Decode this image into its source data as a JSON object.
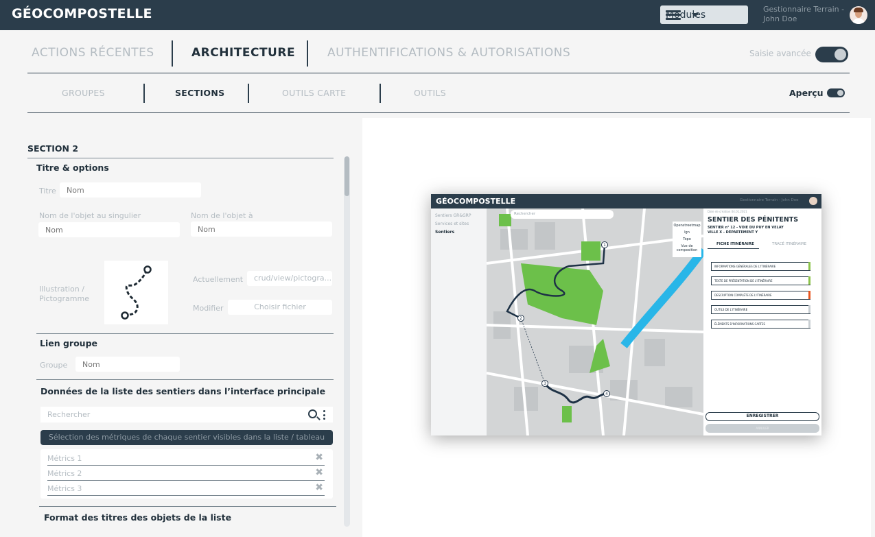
{
  "app": {
    "brand": "GÉOCOMPOSTELLE",
    "modules_label": "Modules",
    "user": "Gestionnaire Terrain - John Doe"
  },
  "main_tabs": {
    "recent": "ACTIONS RÉCENTES",
    "architecture": "ARCHITECTURE",
    "auth": "AUTHENTIFICATIONS & AUTORISATIONS",
    "active": "ARCHITECTURE"
  },
  "saisie_avancee": {
    "label": "Saisie avancée",
    "on": true
  },
  "sub_tabs": {
    "groupes": "GROUPES",
    "sections": "SECTIONS",
    "outils_carte": "OUTILS CARTE",
    "outils": "OUTILS",
    "active": "SECTIONS"
  },
  "apercu": {
    "label": "Aperçu",
    "on": true
  },
  "form": {
    "section_title": "SECTION 2",
    "titre_options": {
      "heading": "Titre & options",
      "titre_label": "Titre",
      "titre_placeholder": "Nom",
      "singular_label": "Nom de l'objet au singulier",
      "singular_placeholder": "Nom",
      "a_label": "Nom de l'objet à",
      "a_placeholder": "Nom",
      "picto_label": "Illustration / Pictogramme",
      "actuellement_label": "Actuellement",
      "actuellement_value": "crud/view/pictogra...",
      "modifier_label": "Modifier",
      "choose_file": "Choisir fichier"
    },
    "lien_groupe": {
      "heading": "Lien groupe",
      "groupe_label": "Groupe",
      "groupe_placeholder": "Nom"
    },
    "donnees": {
      "heading": "Données de la liste des sentiers dans l’interface principale",
      "search_placeholder": "Rechercher",
      "metrics_bar": "Sélection des métriques de chaque sentier visibles dans la liste / tableau",
      "metrics": [
        "Métrics 1",
        "Métrics 2",
        "Métrics 3"
      ]
    },
    "format": {
      "heading": "Format des titres des objets de la liste"
    }
  },
  "preview": {
    "brand": "GÉOCOMPOSTELLE",
    "user": "Gestionnaire Terrain - John Doe",
    "left_items": [
      "Sentiers GR&GRP",
      "Services et sites",
      "Sentiers"
    ],
    "search_placeholder": "Rechercher",
    "layers": [
      "Openstreetmap",
      "Ign",
      "Topo",
      "Vue de composition"
    ],
    "date": "Date de création 04.01.2021",
    "title": "SENTIER DES PÉNITENTS",
    "subtitle": "SENTIER n° 12 - VOIE DU PUY EN VELAY",
    "subtitle2": "VILLE X - DÉPARTEMENT Y",
    "tabs": [
      "FICHE ITINÉRAIRE",
      "TRACÉ ITINÉRAIRE"
    ],
    "items": [
      {
        "label": "INFORMATIONS GÉNÉRALES DE L'ITINÉRAIRE",
        "flag": "#8bc34a"
      },
      {
        "label": "TEXTE DE PRÉSENTATION DE L'ITINÉRAIRE",
        "flag": "#8bc34a"
      },
      {
        "label": "DESCRIPTION COMPLÈTE DE L'ITINÉRAIRE",
        "flag": "#e8541e"
      },
      {
        "label": "OUTILS DE L'ITINÉRAIRE",
        "flag": "#c9cfd3"
      },
      {
        "label": "ÉLÉMENTS D'INFORMATIONS CARTES",
        "flag": "#c9cfd3"
      }
    ],
    "save": "ENREGISTRER",
    "save2": "ANNULER",
    "waypoints": [
      "1",
      "2",
      "3",
      "4"
    ]
  },
  "colors": {
    "navy": "#2b3d4b",
    "green": "#6cc04a",
    "water": "#29b6e8",
    "map": "#d3d5d6"
  }
}
